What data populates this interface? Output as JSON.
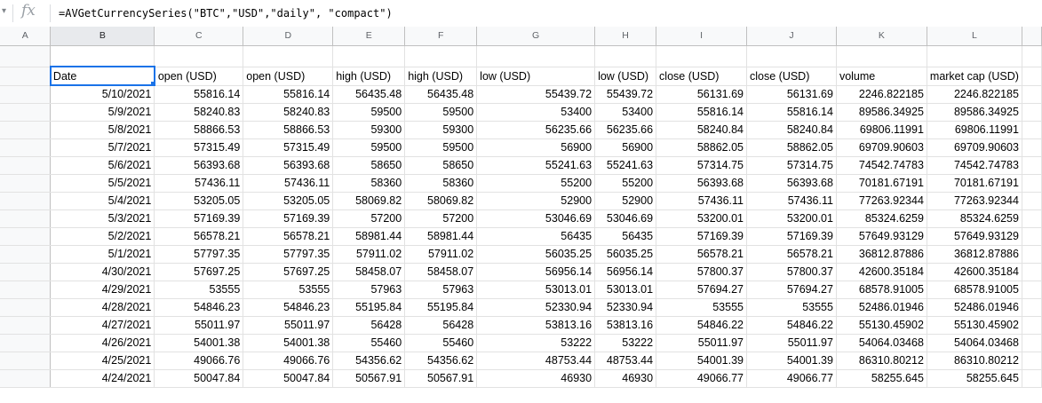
{
  "formula_bar": {
    "fx_label": "fx",
    "formula": "=AVGetCurrencySeries(\"BTC\",\"USD\",\"daily\", \"compact\")"
  },
  "columns": [
    "A",
    "B",
    "C",
    "D",
    "E",
    "F",
    "G",
    "H",
    "I",
    "J",
    "K",
    "L"
  ],
  "headers": [
    "Date",
    "open (USD)",
    "open (USD)",
    "high (USD)",
    "high (USD)",
    "low (USD)",
    "low (USD)",
    "close (USD)",
    "close (USD)",
    "volume",
    "market cap (USD)"
  ],
  "rows": [
    [
      "5/10/2021",
      "55816.14",
      "55816.14",
      "56435.48",
      "56435.48",
      "55439.72",
      "55439.72",
      "56131.69",
      "56131.69",
      "2246.822185",
      "2246.822185"
    ],
    [
      "5/9/2021",
      "58240.83",
      "58240.83",
      "59500",
      "59500",
      "53400",
      "53400",
      "55816.14",
      "55816.14",
      "89586.34925",
      "89586.34925"
    ],
    [
      "5/8/2021",
      "58866.53",
      "58866.53",
      "59300",
      "59300",
      "56235.66",
      "56235.66",
      "58240.84",
      "58240.84",
      "69806.11991",
      "69806.11991"
    ],
    [
      "5/7/2021",
      "57315.49",
      "57315.49",
      "59500",
      "59500",
      "56900",
      "56900",
      "58862.05",
      "58862.05",
      "69709.90603",
      "69709.90603"
    ],
    [
      "5/6/2021",
      "56393.68",
      "56393.68",
      "58650",
      "58650",
      "55241.63",
      "55241.63",
      "57314.75",
      "57314.75",
      "74542.74783",
      "74542.74783"
    ],
    [
      "5/5/2021",
      "57436.11",
      "57436.11",
      "58360",
      "58360",
      "55200",
      "55200",
      "56393.68",
      "56393.68",
      "70181.67191",
      "70181.67191"
    ],
    [
      "5/4/2021",
      "53205.05",
      "53205.05",
      "58069.82",
      "58069.82",
      "52900",
      "52900",
      "57436.11",
      "57436.11",
      "77263.92344",
      "77263.92344"
    ],
    [
      "5/3/2021",
      "57169.39",
      "57169.39",
      "57200",
      "57200",
      "53046.69",
      "53046.69",
      "53200.01",
      "53200.01",
      "85324.6259",
      "85324.6259"
    ],
    [
      "5/2/2021",
      "56578.21",
      "56578.21",
      "58981.44",
      "58981.44",
      "56435",
      "56435",
      "57169.39",
      "57169.39",
      "57649.93129",
      "57649.93129"
    ],
    [
      "5/1/2021",
      "57797.35",
      "57797.35",
      "57911.02",
      "57911.02",
      "56035.25",
      "56035.25",
      "56578.21",
      "56578.21",
      "36812.87886",
      "36812.87886"
    ],
    [
      "4/30/2021",
      "57697.25",
      "57697.25",
      "58458.07",
      "58458.07",
      "56956.14",
      "56956.14",
      "57800.37",
      "57800.37",
      "42600.35184",
      "42600.35184"
    ],
    [
      "4/29/2021",
      "53555",
      "53555",
      "57963",
      "57963",
      "53013.01",
      "53013.01",
      "57694.27",
      "57694.27",
      "68578.91005",
      "68578.91005"
    ],
    [
      "4/28/2021",
      "54846.23",
      "54846.23",
      "55195.84",
      "55195.84",
      "52330.94",
      "52330.94",
      "53555",
      "53555",
      "52486.01946",
      "52486.01946"
    ],
    [
      "4/27/2021",
      "55011.97",
      "55011.97",
      "56428",
      "56428",
      "53813.16",
      "53813.16",
      "54846.22",
      "54846.22",
      "55130.45902",
      "55130.45902"
    ],
    [
      "4/26/2021",
      "54001.38",
      "54001.38",
      "55460",
      "55460",
      "53222",
      "53222",
      "55011.97",
      "55011.97",
      "54064.03468",
      "54064.03468"
    ],
    [
      "4/25/2021",
      "49066.76",
      "49066.76",
      "54356.62",
      "54356.62",
      "48753.44",
      "48753.44",
      "54001.39",
      "54001.39",
      "86310.80212",
      "86310.80212"
    ],
    [
      "4/24/2021",
      "50047.84",
      "50047.84",
      "50567.91",
      "50567.91",
      "46930",
      "46930",
      "49066.77",
      "49066.77",
      "58255.645",
      "58255.645"
    ]
  ]
}
